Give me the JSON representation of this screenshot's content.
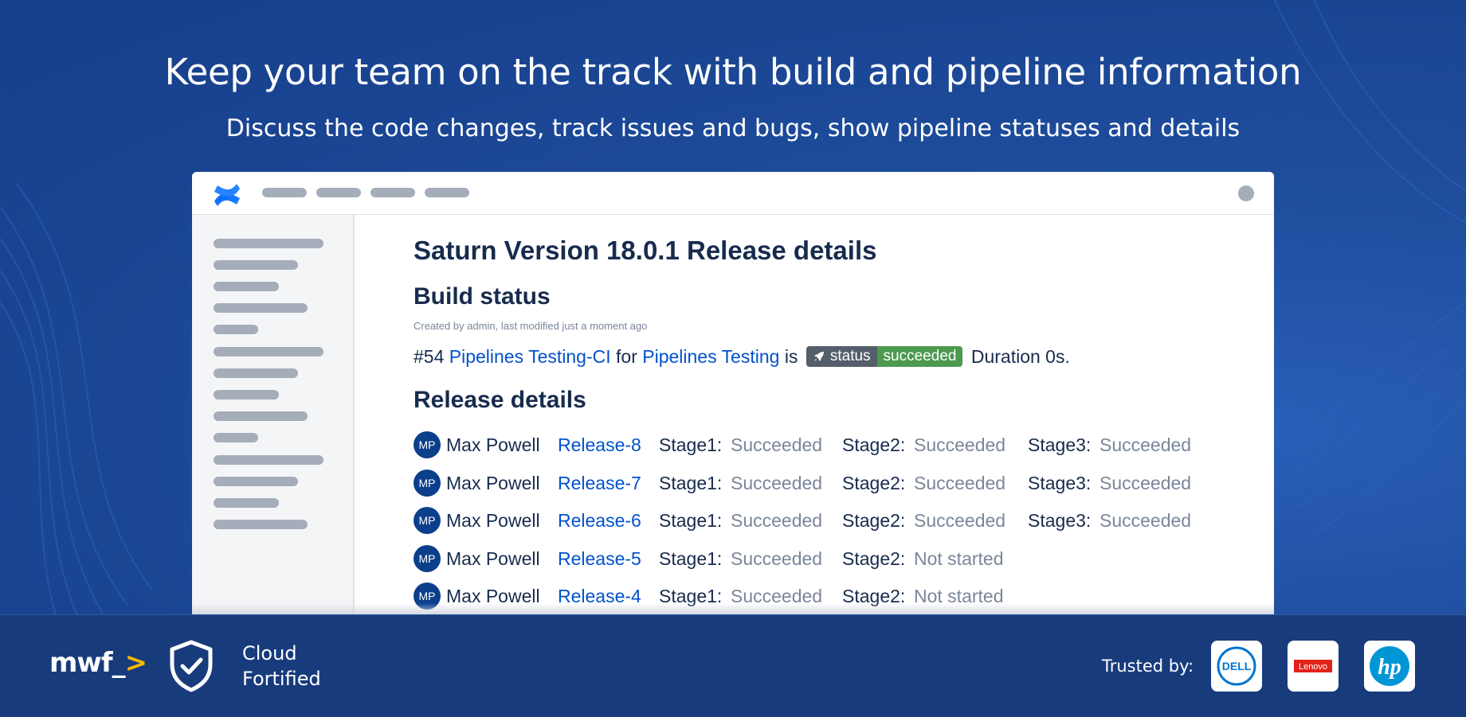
{
  "hero": {
    "headline": "Keep your team on the track with build and pipeline information",
    "subline": "Discuss the code changes, track issues and bugs, show pipeline statuses and details"
  },
  "window": {
    "logo_icon": "confluence-logo",
    "page_title": "Saturn Version 18.0.1 Release details",
    "build_status": {
      "heading": "Build status",
      "meta": "Created by admin, last modified just a moment ago",
      "build_number": "#54",
      "pipeline_link": "Pipelines Testing-CI",
      "for_text": "for",
      "project_link": "Pipelines Testing",
      "is_text": "is",
      "badge_label": "status",
      "badge_value": "succeeded",
      "badge_icon": "rocket-icon",
      "duration": "Duration 0s."
    },
    "release_details": {
      "heading": "Release details",
      "rows": [
        {
          "initials": "MP",
          "user": "Max Powell",
          "release": "Release-8",
          "stages": [
            {
              "label": "Stage1:",
              "status": "Succeeded"
            },
            {
              "label": "Stage2:",
              "status": "Succeeded"
            },
            {
              "label": "Stage3:",
              "status": "Succeeded"
            }
          ]
        },
        {
          "initials": "MP",
          "user": "Max Powell",
          "release": "Release-7",
          "stages": [
            {
              "label": "Stage1:",
              "status": "Succeeded"
            },
            {
              "label": "Stage2:",
              "status": "Succeeded"
            },
            {
              "label": "Stage3:",
              "status": "Succeeded"
            }
          ]
        },
        {
          "initials": "MP",
          "user": "Max Powell",
          "release": "Release-6",
          "stages": [
            {
              "label": "Stage1:",
              "status": "Succeeded"
            },
            {
              "label": "Stage2:",
              "status": "Succeeded"
            },
            {
              "label": "Stage3:",
              "status": "Succeeded"
            }
          ]
        },
        {
          "initials": "MP",
          "user": "Max Powell",
          "release": "Release-5",
          "stages": [
            {
              "label": "Stage1:",
              "status": "Succeeded"
            },
            {
              "label": "Stage2:",
              "status": "Not started"
            }
          ]
        },
        {
          "initials": "MP",
          "user": "Max Powell",
          "release": "Release-4",
          "stages": [
            {
              "label": "Stage1:",
              "status": "Succeeded"
            },
            {
              "label": "Stage2:",
              "status": "Not started"
            }
          ]
        }
      ]
    }
  },
  "footer": {
    "brand": "mwf_",
    "brand_arrow": ">",
    "badge_icon": "shield-check-icon",
    "badge_line1": "Cloud",
    "badge_line2": "Fortified",
    "trusted_label": "Trusted by:",
    "partners": [
      {
        "name": "DELL",
        "icon": "dell-logo"
      },
      {
        "name": "Lenovo",
        "icon": "lenovo-logo"
      },
      {
        "name": "hp",
        "icon": "hp-logo"
      }
    ]
  },
  "colors": {
    "background": "#1f4f9f",
    "footer": "#183b7c",
    "link": "#0052cc",
    "badge_success": "#4c9a4f",
    "avatar": "#0b3f8c"
  }
}
